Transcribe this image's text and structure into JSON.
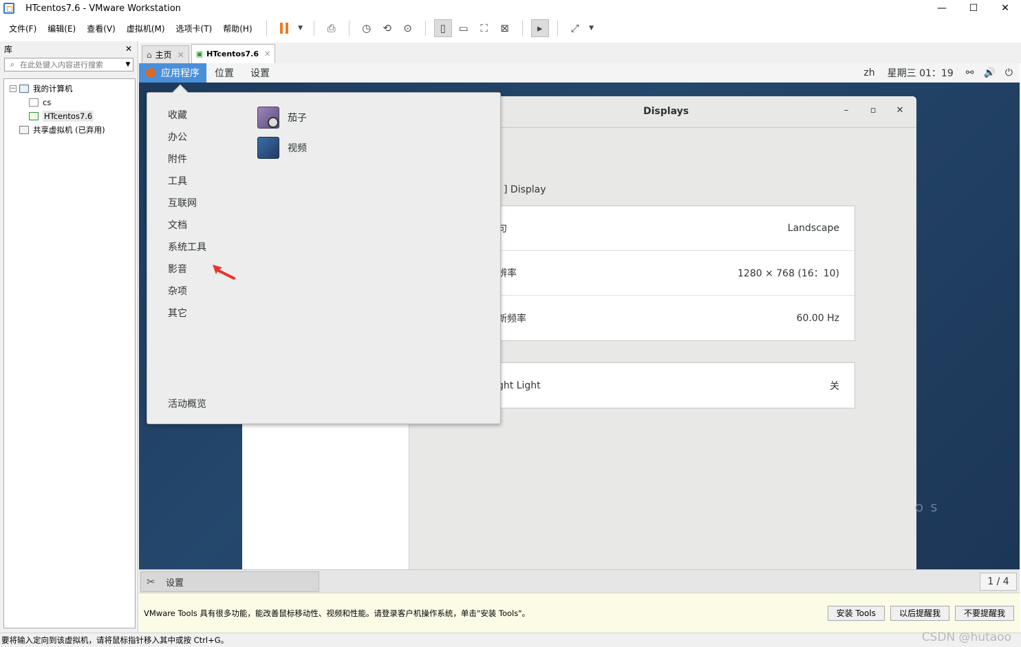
{
  "window": {
    "title": "HTcentos7.6 - VMware Workstation",
    "minimize": "—",
    "maximize": "☐",
    "close": "✕"
  },
  "menubar": {
    "items": [
      "文件(F)",
      "编辑(E)",
      "查看(V)",
      "虚拟机(M)",
      "选项卡(T)",
      "帮助(H)"
    ]
  },
  "library": {
    "title": "库",
    "close": "✕",
    "search_placeholder": "在此处键入内容进行搜索",
    "tree": {
      "root": "我的计算机",
      "children": [
        "cs",
        "HTcentos7.6"
      ],
      "shared": "共享虚拟机 (已弃用)"
    }
  },
  "tabs": [
    {
      "label": "主页"
    },
    {
      "label": "HTcentos7.6"
    }
  ],
  "gnome": {
    "apps_label": "应用程序",
    "places_label": "位置",
    "settings_label": "设置",
    "lang": "zh",
    "clock": "星期三 01：19"
  },
  "apps_menu": {
    "categories": [
      "收藏",
      "办公",
      "附件",
      "工具",
      "互联网",
      "文档",
      "系统工具",
      "影音",
      "杂项",
      "其它"
    ],
    "overview": "活动概览",
    "apps": [
      {
        "label": "茄子",
        "icon": "cheese-icon"
      },
      {
        "label": "视频",
        "icon": "video-icon"
      }
    ]
  },
  "settings_window": {
    "title": "Displays",
    "minimize": "–",
    "maximize": "▫",
    "close": "✕",
    "section": "] Display",
    "rows": [
      {
        "label": "句",
        "value": "Landscape"
      },
      {
        "label": "辨率",
        "value": "1280 × 768 (16：10)"
      },
      {
        "label": "新频率",
        "value": "60.00 Hz"
      }
    ],
    "night_light": {
      "label": "ght Light",
      "value": "关"
    },
    "watermark": "O S"
  },
  "guest_status": {
    "task_label": "设置",
    "pager": "1 / 4"
  },
  "notification": {
    "message": "VMware Tools 具有很多功能，能改善鼠标移动性、视频和性能。请登录客户机操作系统，单击\"安装 Tools\"。",
    "buttons": [
      "安装 Tools",
      "以后提醒我",
      "不要提醒我"
    ]
  },
  "statusbar": {
    "text": "要将输入定向到该虚拟机，请将鼠标指针移入其中或按 Ctrl+G。",
    "watermark": "CSDN @hutaoo"
  },
  "colors": {
    "accent": "#4a90d9",
    "pause": "#f07a1a",
    "arrow": "#e8342a"
  }
}
